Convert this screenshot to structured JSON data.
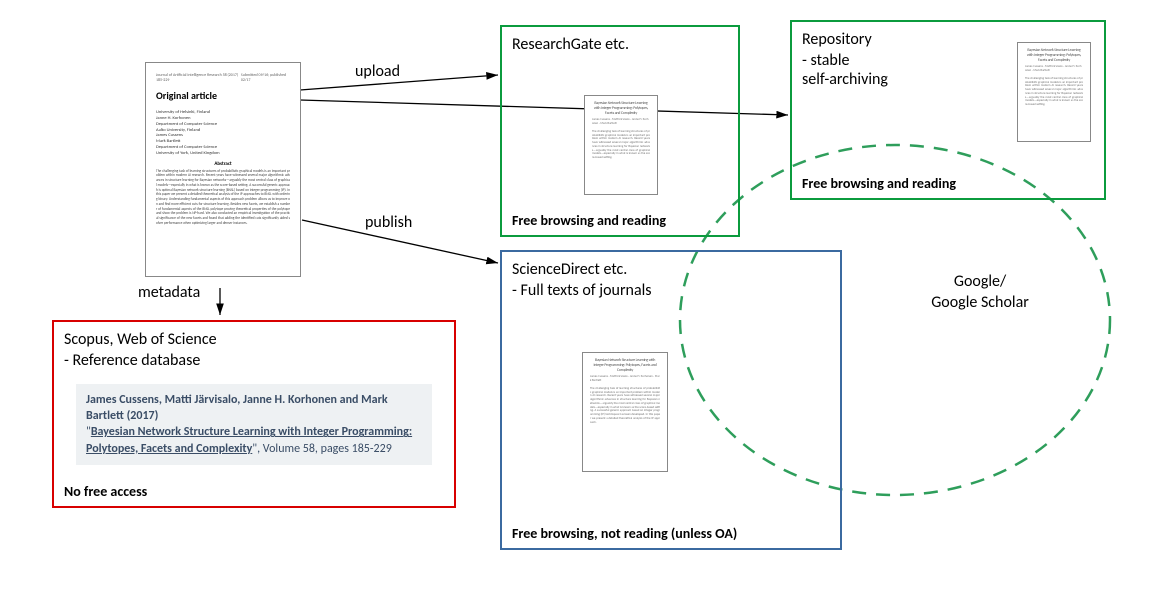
{
  "original": {
    "label": "Original article"
  },
  "arrows": {
    "upload": "upload",
    "publish": "publish",
    "metadata": "metadata"
  },
  "researchgate": {
    "title": "ResearchGate etc.",
    "caption": "Free browsing and reading"
  },
  "repository": {
    "title": "Repository",
    "line1": "- stable",
    "line2": "self-archiving",
    "caption": "Free browsing and reading"
  },
  "scopus": {
    "title": "Scopus, Web of Science",
    "subtitle": "- Reference database",
    "caption": "No free access",
    "reference": {
      "authors": "James Cussens, Matti Järvisalo, Janne H. Korhonen and Mark Bartlett (2017)",
      "paper_title": "Bayesian Network Structure Learning with Integer Programming: Polytopes, Facets and Complexity",
      "suffix": ", Volume 58, pages 185-229"
    }
  },
  "sciencedirect": {
    "title": "ScienceDirect etc.",
    "subtitle": "- Full texts of journals",
    "caption": "Free browsing, not reading (unless OA)"
  },
  "google": {
    "line1": "Google/",
    "line2": "Google Scholar"
  }
}
